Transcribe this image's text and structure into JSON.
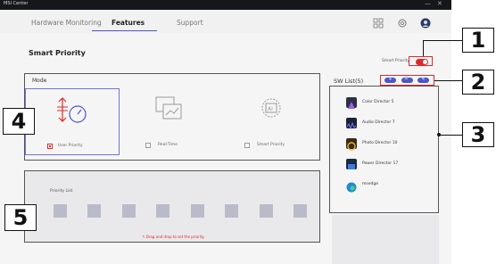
{
  "app": {
    "title": "MSI Center",
    "minimize": "—",
    "close": "✕"
  },
  "nav": {
    "tabs": [
      "Hardware Monitoring",
      "Features",
      "Support"
    ],
    "active_tab": "Features",
    "icons": [
      "grid-icon",
      "gear-icon",
      "avatar-icon"
    ]
  },
  "page": {
    "title": "Smart Priority",
    "toggle_label": "Smart Priority",
    "toggle_on": true
  },
  "mode": {
    "title": "Mode",
    "options": [
      {
        "label": "User Priority",
        "checked": true
      },
      {
        "label": "Real-Time",
        "checked": false
      },
      {
        "label": "Smart Priority",
        "checked": false
      }
    ]
  },
  "sw_list": {
    "title": "SW List(5)",
    "buttons": [
      "+",
      "🔍",
      "✎"
    ],
    "items": [
      {
        "name": "Color Director 5",
        "icon": "color-director-icon"
      },
      {
        "name": "Audio Director 7",
        "icon": "audio-director-icon"
      },
      {
        "name": "Photo Director 10",
        "icon": "photo-director-icon"
      },
      {
        "name": "Power Director 17",
        "icon": "power-director-icon"
      },
      {
        "name": "msedge",
        "icon": "edge-icon"
      }
    ]
  },
  "priority": {
    "title": "Priority List",
    "slots": 8,
    "hint": "Drag and drop to set the priority."
  },
  "callouts": [
    "1",
    "2",
    "3",
    "4",
    "5"
  ],
  "colors": {
    "accent": "#4d55c9",
    "red": "#e2272a",
    "titlebar": "#16171b"
  }
}
